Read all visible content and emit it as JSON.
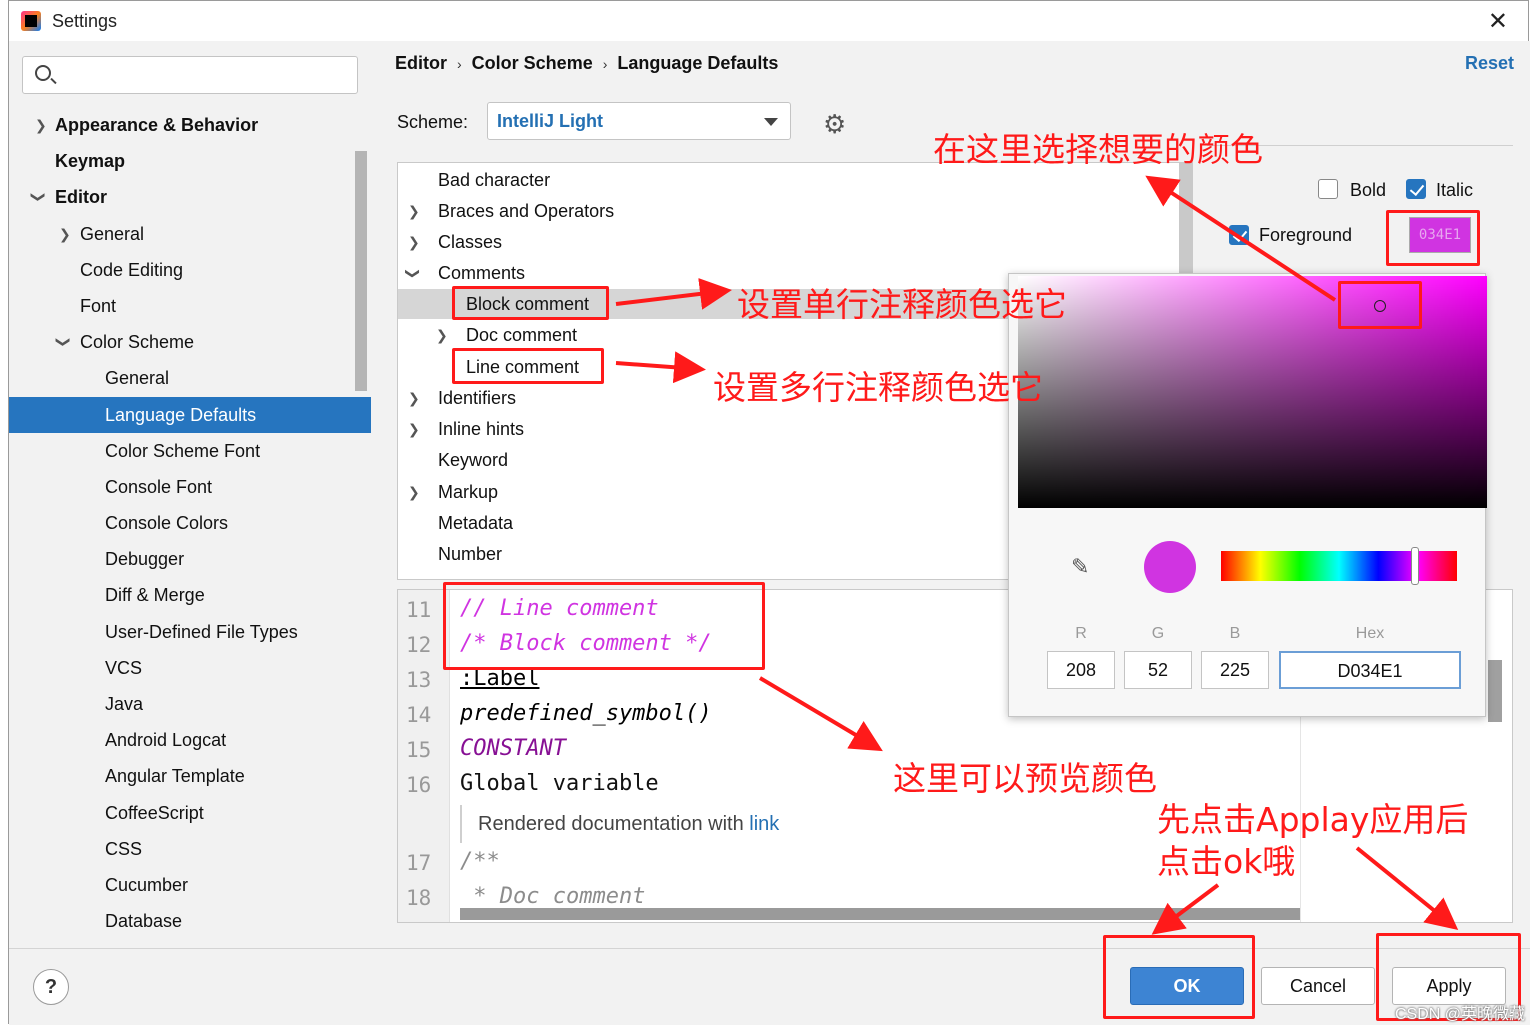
{
  "window": {
    "title": "Settings",
    "close": "✕"
  },
  "search": {
    "placeholder": ""
  },
  "sidebar": {
    "items": [
      {
        "label": "Appearance & Behavior"
      },
      {
        "label": "Keymap"
      },
      {
        "label": "Editor"
      },
      {
        "label": "General"
      },
      {
        "label": "Code Editing"
      },
      {
        "label": "Font"
      },
      {
        "label": "Color Scheme"
      },
      {
        "label": "General"
      },
      {
        "label": "Language Defaults"
      },
      {
        "label": "Color Scheme Font"
      },
      {
        "label": "Console Font"
      },
      {
        "label": "Console Colors"
      },
      {
        "label": "Debugger"
      },
      {
        "label": "Diff & Merge"
      },
      {
        "label": "User-Defined File Types"
      },
      {
        "label": "VCS"
      },
      {
        "label": "Java"
      },
      {
        "label": "Android Logcat"
      },
      {
        "label": "Angular Template"
      },
      {
        "label": "CoffeeScript"
      },
      {
        "label": "CSS"
      },
      {
        "label": "Cucumber"
      },
      {
        "label": "Database"
      }
    ]
  },
  "breadcrumb": {
    "a": "Editor",
    "b": "Color Scheme",
    "c": "Language Defaults",
    "sep": "›"
  },
  "reset": "Reset",
  "scheme": {
    "label": "Scheme:",
    "value": "IntelliJ Light"
  },
  "elements": [
    {
      "label": "Bad character"
    },
    {
      "label": "Braces and Operators"
    },
    {
      "label": "Classes"
    },
    {
      "label": "Comments"
    },
    {
      "label": "Block comment"
    },
    {
      "label": "Doc comment"
    },
    {
      "label": "Line comment"
    },
    {
      "label": "Identifiers"
    },
    {
      "label": "Inline hints"
    },
    {
      "label": "Keyword"
    },
    {
      "label": "Markup"
    },
    {
      "label": "Metadata"
    },
    {
      "label": "Number"
    }
  ],
  "options": {
    "bold": "Bold",
    "italic": "Italic",
    "foreground": "Foreground",
    "fg_value": "034E1"
  },
  "picker": {
    "r_label": "R",
    "g_label": "G",
    "b_label": "B",
    "hex_label": "Hex",
    "r": "208",
    "g": "52",
    "b": "225",
    "hex": "D034E1",
    "color": "#d034e1"
  },
  "preview": {
    "lines": [
      {
        "num": "11",
        "text": "// Line comment"
      },
      {
        "num": "12",
        "text": "/* Block comment */"
      },
      {
        "num": "13",
        "text": ":Label"
      },
      {
        "num": "14",
        "text": "predefined_symbol()"
      },
      {
        "num": "15",
        "text": "CONSTANT"
      },
      {
        "num": "16",
        "text": "Global variable"
      },
      {
        "num": "17",
        "text": "/**"
      },
      {
        "num": "18",
        "text": " * Doc comment"
      }
    ],
    "rendered_doc": "Rendered documentation with",
    "rendered_link": "link"
  },
  "buttons": {
    "ok": "OK",
    "cancel": "Cancel",
    "apply": "Apply",
    "help": "?"
  },
  "annotations": {
    "pick_color": "在这里选择想要的颜色",
    "block_hint": "设置单行注释颜色选它",
    "line_hint": "设置多行注释颜色选它",
    "preview_hint": "这里可以预览颜色",
    "apply_hint_1": "先点击Applay应用后",
    "apply_hint_2": "点击ok哦"
  },
  "watermark": "CSDN @英晚微藏",
  "colors": {
    "accent": "#2675bf",
    "annotation": "#ff1a1a",
    "comment": "#d034e1"
  }
}
